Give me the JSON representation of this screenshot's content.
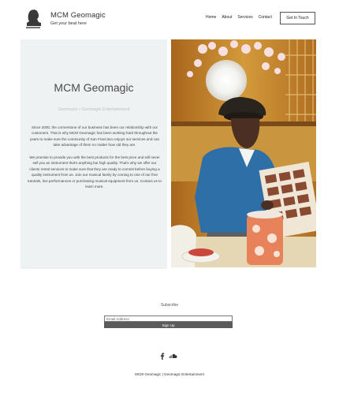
{
  "header": {
    "brand_name": "MCM Geomagic",
    "tagline": "Get your beat here",
    "nav": [
      "Home",
      "About",
      "Services",
      "Contact"
    ],
    "cta_label": "Get In Touch"
  },
  "about": {
    "title": "MCM Geomagic",
    "subtitle": "Geomusic • Geomagic Entertainment",
    "paragraph1": "Since 2000, the cornerstone of our business has been our relationship with our customers. That is why MCM Geomagic has been working hard throughout the years to make sure the community of San Francisco enjoys our services and can take advantage of them no matter how old they are.",
    "paragraph2": "We promise to provide you with the best products for the best price and will never sell you an instrument that's anything but high quality. That's why we offer our clients rental services to make sure that they are ready to commit before buying a quality instrument from us. Join our musical family by coming to one of our free tutorials, live performances or purchasing musical equipment from us. Contact us to learn more."
  },
  "subscribe": {
    "label": "Subscribe",
    "email_placeholder": "Email Address",
    "button_label": "Sign Up"
  },
  "social": {
    "icons": [
      "facebook-icon",
      "soundcloud-icon"
    ]
  },
  "footer": {
    "text": "MCM Geomagic | Geomagic Entertainment"
  },
  "colors": {
    "about_bg": "#eef2f3",
    "signup_bg": "#5b5b5b"
  }
}
